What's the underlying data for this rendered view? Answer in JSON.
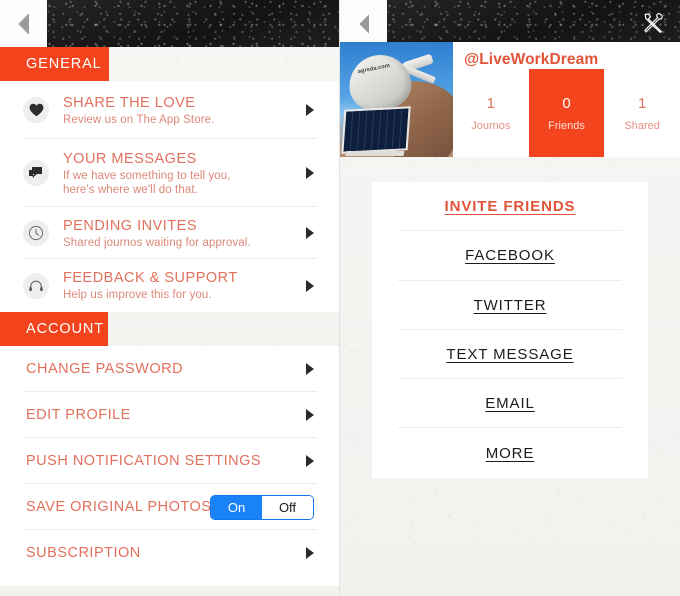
{
  "app": {
    "accent_color": "#f4441e",
    "title_color": "#e2705c",
    "toggle_on_color": "#1a82f7"
  },
  "left_panel": {
    "back_icon": "chevron-left-icon",
    "sections": [
      {
        "header": "GENERAL",
        "items": [
          {
            "icon": "heart-icon",
            "title": "SHARE THE LOVE",
            "subtitle": "Review us on The App Store.",
            "chevron": "chevron-right-icon"
          },
          {
            "icon": "chat-bubbles-icon",
            "title": "YOUR MESSAGES",
            "subtitle": "If we have something to tell you, here's where we'll do that.",
            "chevron": "chevron-right-icon"
          },
          {
            "icon": "clock-icon",
            "title": "PENDING INVITES",
            "subtitle": "Shared journos waiting for approval.",
            "chevron": "chevron-right-icon"
          },
          {
            "icon": "headset-icon",
            "title": "FEEDBACK & SUPPORT",
            "subtitle": "Help us improve this for you.",
            "chevron": "chevron-right-icon"
          }
        ]
      },
      {
        "header": "ACCOUNT",
        "items": [
          {
            "title": "CHANGE PASSWORD",
            "chevron": "chevron-right-icon"
          },
          {
            "title": "EDIT PROFILE",
            "chevron": "chevron-right-icon"
          },
          {
            "title": "PUSH NOTIFICATION SETTINGS",
            "chevron": "chevron-right-icon"
          },
          {
            "title": "SAVE ORIGINAL PHOTOS",
            "control": "segmented-toggle",
            "options": [
              "On",
              "Off"
            ],
            "selected": "On"
          },
          {
            "title": "SUBSCRIPTION",
            "chevron": "chevron-right-icon"
          }
        ]
      }
    ]
  },
  "right_panel": {
    "back_icon": "chevron-left-icon",
    "tools_icon": "wrench-screwdriver-icon",
    "profile": {
      "avatar_alt": "satellite-dish-and-solar-panel-photo",
      "avatar_watermark": "agreda.com",
      "handle": "@LiveWorkDream",
      "stats": [
        {
          "value": "1",
          "label": "Journos",
          "active": false
        },
        {
          "value": "0",
          "label": "Friends",
          "active": true
        },
        {
          "value": "1",
          "label": "Shared",
          "active": false
        }
      ]
    },
    "invite": {
      "heading": "INVITE FRIENDS",
      "options": [
        "FACEBOOK",
        "TWITTER",
        "TEXT MESSAGE",
        "EMAIL",
        "MORE"
      ]
    }
  }
}
